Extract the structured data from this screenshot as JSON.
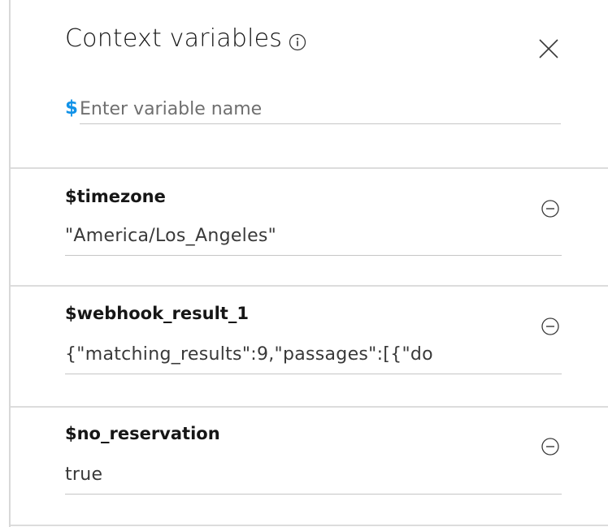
{
  "header": {
    "title": "Context variables",
    "new_variable": {
      "prefix": "$",
      "placeholder": "Enter variable name"
    }
  },
  "variables": [
    {
      "name": "$timezone",
      "value": "\"America/Los_Angeles\""
    },
    {
      "name": "$webhook_result_1",
      "value": "{\"matching_results\":9,\"passages\":[{\"do"
    },
    {
      "name": "$no_reservation",
      "value": "true"
    }
  ],
  "colors": {
    "accent": "#1192e8",
    "text": "#161616",
    "muted": "#6f6f6f",
    "divider": "#dcdcdc"
  },
  "icons": {
    "info": "info-icon",
    "close": "close-icon",
    "remove": "minus-circle-icon"
  }
}
